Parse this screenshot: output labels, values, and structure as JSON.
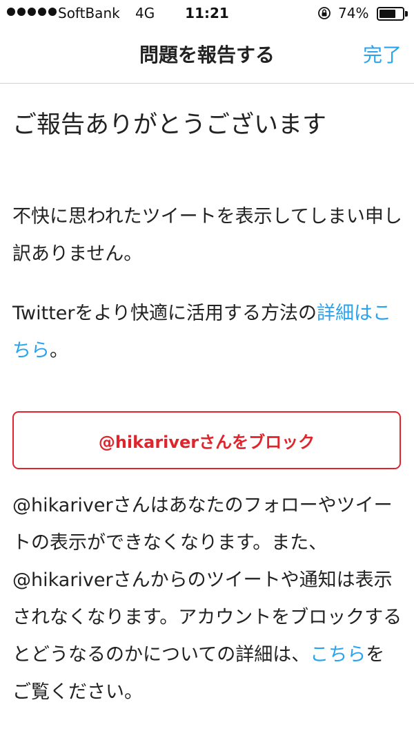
{
  "status_bar": {
    "carrier": "SoftBank",
    "network": "4G",
    "time": "11:21",
    "battery_percent": "74%",
    "battery_level": 0.74,
    "signal_bars": 5
  },
  "nav": {
    "title": "問題を報告する",
    "done_label": "完了"
  },
  "content": {
    "heading": "ご報告ありがとうございます",
    "apology": "不快に思われたツイートを表示してしまい申し訳ありません。",
    "tips_prefix": "Twitterをより快適に活用する方法の",
    "tips_link": "詳細はこちら",
    "tips_suffix": "。",
    "block_button": "@hikariverさんをブロック",
    "block_info": "@hikariverさんはあなたのフォローやツイートの表示ができなくなります。また、@hikariverさんからのツイートや通知は表示されなくなります。アカウントをブロックするとどうなるのかについての詳細は、",
    "block_info_link": "こちら",
    "block_info_suffix": "をご覧ください。"
  },
  "colors": {
    "link": "#2aa3ef",
    "danger": "#e0242c",
    "text": "#222222"
  }
}
